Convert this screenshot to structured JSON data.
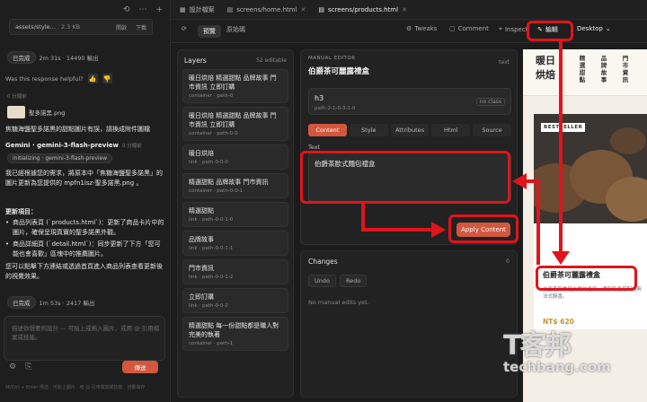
{
  "chat": {
    "file_name": "assets/style…",
    "file_size": "2.3 KB",
    "file_btn_preview": "開啟",
    "file_btn_download": "下載",
    "done1_label": "已完成",
    "done1_stats": "2m 31s · 14490 輸出",
    "helpful": "Was this response helpful?",
    "meta1": "0 分鐘前",
    "attach_name": "聖多諾黑.png",
    "user_msg": "焦糖海鹽聖多諾黑的甜點圖片有誤，請換成附件圖檔",
    "model_name": "Gemini · gemini-3-flash-preview",
    "model_time": "0 分鐘前",
    "init_tag": "initializing · gemini-3-flash-preview",
    "reply_intro": "我已經根據您的需求，將原本中「焦糖海鹽聖多諾黑」的圖片更新為您提供的 mpfn1isz-聖多諾黑.png 。",
    "update_title": "更新項目：",
    "update_items": [
      "商品列表頁 (`products.html`)：更新了商品卡片中的圖片，確保呈現真實的聖多諾黑外觀。",
      "商品詳細頁 (`detail.html`)：同步更新了下方「您可能也會喜歡」區塊中的推薦圖片。"
    ],
    "reply_outro": "您可以點擊下方連結或透過首頁進入商品列表查看更新後的視覺效果。",
    "done2_label": "已完成",
    "done2_stats": "1m 53s · 2417 輸出",
    "composer_placeholder": "描述你想要的設計 — 可貼上或拖入圖片，或用 @ 引用檔案或技能。",
    "send_label": "傳送",
    "footer_text": "⌘/Ctrl + Enter 傳送 · 可貼上圖片 · 用 @ 引用檔案或技能 · 自動儲存"
  },
  "tabs": [
    {
      "label": "設計檔案"
    },
    {
      "label": "screens/home.html"
    },
    {
      "label": "screens/products.html"
    }
  ],
  "toolbar": {
    "preview": "預覽",
    "source": "原始碼",
    "tweaks": "Tweaks",
    "comment": "Comment",
    "inspect": "Inspect",
    "edit": "編輯",
    "device": "Desktop"
  },
  "layers": {
    "title": "Layers",
    "count": "52 editable",
    "items": [
      {
        "text": "暖日烘焙 精選甜點 品牌故事 門市資訊 立即訂購",
        "path": "container · path-0"
      },
      {
        "text": "暖日烘焙 精選甜點 品牌故事 門市資訊 立即訂購",
        "path": "container · path-0-0"
      },
      {
        "text": "暖日烘焙",
        "path": "link · path-0-0-0"
      },
      {
        "text": "精選甜點 品牌故事 門市資訊",
        "path": "container · path-0-0-1"
      },
      {
        "text": "精選甜點",
        "path": "link · path-0-0-1-0"
      },
      {
        "text": "品牌故事",
        "path": "link · path-0-0-1-1"
      },
      {
        "text": "門市資訊",
        "path": "link · path-0-0-1-2"
      },
      {
        "text": "立即訂購",
        "path": "link · path-0-0-2"
      },
      {
        "text": "精選甜點 每一份甜點都是職人對完美的執著",
        "path": "container · path-1"
      }
    ]
  },
  "editor": {
    "header": "MANUAL EDITOR",
    "title": "伯爵茶可麗露禮盒",
    "badge": "text",
    "sel_tag": "h3",
    "sel_path": "path-2-1-0-3-1-0",
    "sel_class": "no class",
    "tabs": [
      "Content",
      "Style",
      "Attributes",
      "Html",
      "Source"
    ],
    "text_label": "Text",
    "text_value": "伯爵茶歐式麵包禮盒",
    "apply": "Apply Content"
  },
  "changes": {
    "title": "Changes",
    "count": "0",
    "undo": "Undo",
    "redo": "Redo",
    "empty": "No manual edits yet."
  },
  "preview": {
    "brand": "暖日烘焙",
    "nav": [
      "精選甜點",
      "品牌故事",
      "門市資訊"
    ],
    "badge": "BESTSELLER",
    "product_title": "伯爵茶可麗露禮盒",
    "product_desc": "伯爵茶與焦糖交織的香氣，濃郁奶香搭配經典法式酥香。",
    "price": "NT$ 620"
  },
  "watermark": {
    "big": "T客邦",
    "small": "techbang.com"
  }
}
